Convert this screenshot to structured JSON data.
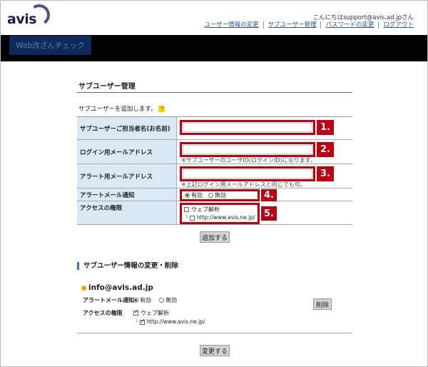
{
  "header": {
    "logo_text": "avis",
    "greeting": "こんにちはsupport@avis.ad.jpさん",
    "nav": [
      "ユーザー情報の変更",
      "サブユーザー管理",
      "パスワードの変更",
      "ログアウト"
    ],
    "tab_label": "Web改ざんチェック"
  },
  "page": {
    "title": "サブユーザー管理",
    "intro": "サブユーザーを追加します。",
    "help_badge": "?"
  },
  "form": {
    "rows": [
      {
        "label": "サブユーザーご担当者名(お名前)",
        "num": "1."
      },
      {
        "label": "ログイン用メールアドレス",
        "num": "2.",
        "note": "※サブユーザーのユーザID(ログインID)になります。"
      },
      {
        "label": "アラート用メールアドレス",
        "num": "3.",
        "note": "※上記ログイン用メールアドレスと同じでも可。"
      },
      {
        "label": "アラートメール通知",
        "num": "4.",
        "opt_on": "有効",
        "opt_off": "無効"
      },
      {
        "label": "アクセスの権限",
        "num": "5.",
        "perm": "ウェブ解析",
        "site": "http://www.avis.ne.jp/"
      }
    ],
    "add_button": "追加する"
  },
  "existing": {
    "section_title": "サブユーザー情報の変更・削除",
    "user": "info@avis.ad.jp",
    "alert_label": "アラートメール通知",
    "opt_on": "有効",
    "opt_off": "無効",
    "access_label": "アクセスの権限",
    "perm": "ウェブ解析",
    "site": "http://www.avis.ne.jp/",
    "delete_button": "削除",
    "update_button": "変更する"
  },
  "colors": {
    "accent_red": "#c00010",
    "label_bg": "#d9e9f6",
    "link_blue": "#2a55a8"
  }
}
